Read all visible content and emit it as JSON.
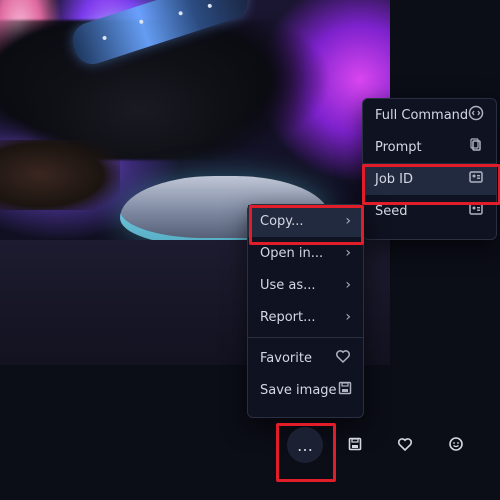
{
  "context_menu": {
    "items": [
      {
        "label": "Copy..."
      },
      {
        "label": "Open in..."
      },
      {
        "label": "Use as..."
      },
      {
        "label": "Report..."
      }
    ],
    "favorite_label": "Favorite",
    "save_image_label": "Save image"
  },
  "submenu": {
    "items": [
      {
        "label": "Full Command",
        "icon": "code-icon"
      },
      {
        "label": "Prompt",
        "icon": "copy-icon"
      },
      {
        "label": "Job ID",
        "icon": "id-card-icon"
      },
      {
        "label": "Seed",
        "icon": "id-card-icon"
      }
    ]
  },
  "actions": {
    "more_label": "…",
    "save_icon": "save-icon",
    "heart_icon": "heart-icon",
    "smile_icon": "smile-icon"
  },
  "colors": {
    "highlight": "#e11d2a",
    "menu_bg": "#0f1220",
    "menu_border": "#2a3042",
    "text": "#d5d8e3",
    "accent_active_bg": "#222a3f"
  }
}
